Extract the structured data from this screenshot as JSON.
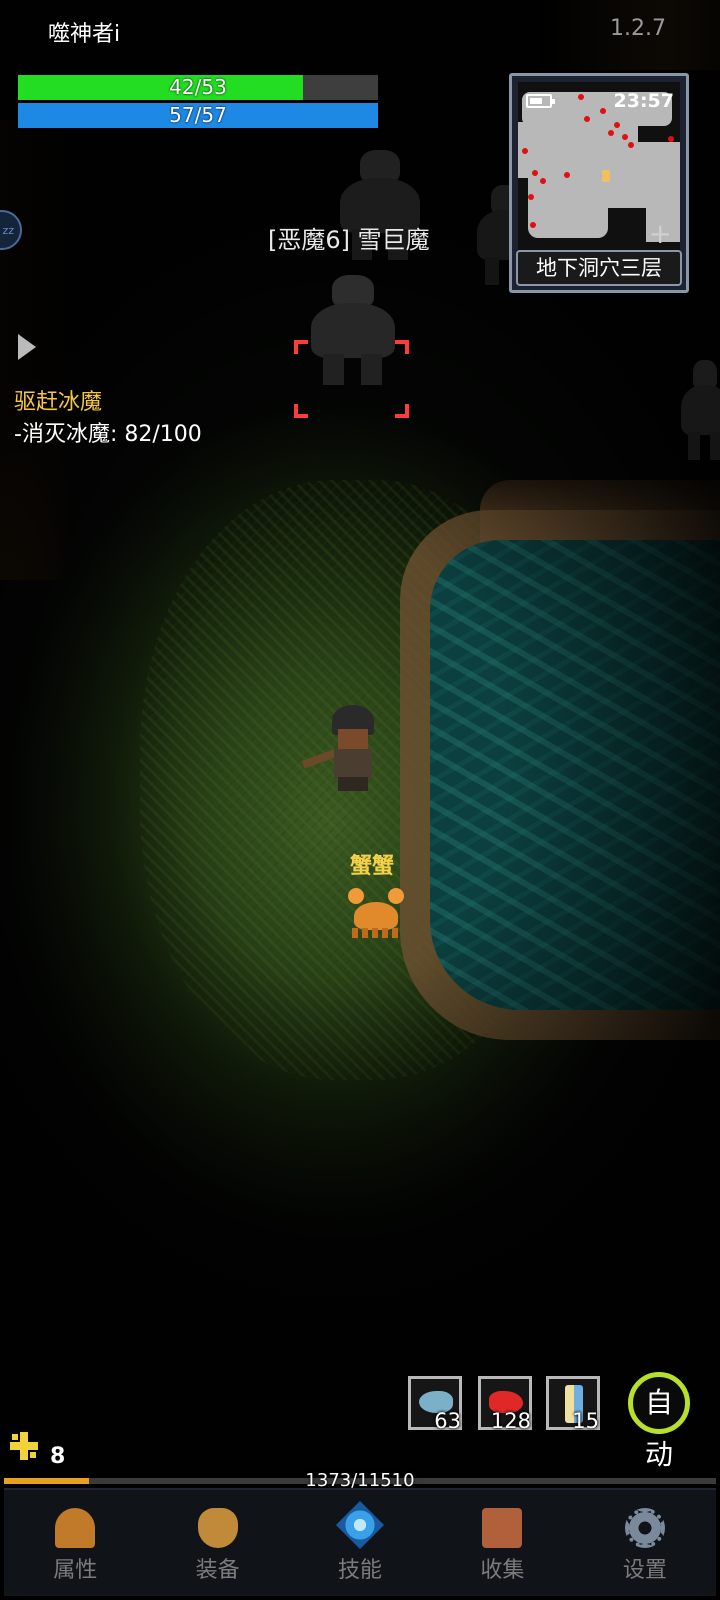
{
  "header": {
    "player_name": "噬神者i",
    "version": "1.2.7"
  },
  "stats": {
    "hp": {
      "text": "42/53",
      "current": 42,
      "max": 53,
      "color": "#22dd22"
    },
    "mp": {
      "text": "57/57",
      "current": 57,
      "max": 57,
      "color": "#1e88e5"
    }
  },
  "quest": {
    "title": "驱赶冰魔",
    "objective": "-消灭冰魔: 82/100"
  },
  "minimap": {
    "time": "23:57",
    "floor_name": "地下洞穴三层",
    "plus": "+"
  },
  "world": {
    "target_name": "[恶魔6] 雪巨魔",
    "pet_name": "蟹蟹"
  },
  "quick_slots": [
    {
      "icon": "fish-icon",
      "count": "63"
    },
    {
      "icon": "meat-icon",
      "count": "128"
    },
    {
      "icon": "scroll-icon",
      "count": "15"
    }
  ],
  "auto_button": "自动",
  "level": {
    "value": "8",
    "xp_text": "1373/11510",
    "xp_current": 1373,
    "xp_max": 11510
  },
  "nav": [
    {
      "label": "属性",
      "icon": "helmet-icon"
    },
    {
      "label": "装备",
      "icon": "bag-icon"
    },
    {
      "label": "技能",
      "icon": "skill-gem-icon"
    },
    {
      "label": "收集",
      "icon": "book-icon"
    },
    {
      "label": "设置",
      "icon": "gear-icon"
    }
  ],
  "colors": {
    "quest_title": "#f5c742",
    "pet_name": "#f3d24a",
    "target_marker": "#ff3b3b",
    "auto_ring": "#b8e02a",
    "xp_fill": "#e8a020"
  }
}
